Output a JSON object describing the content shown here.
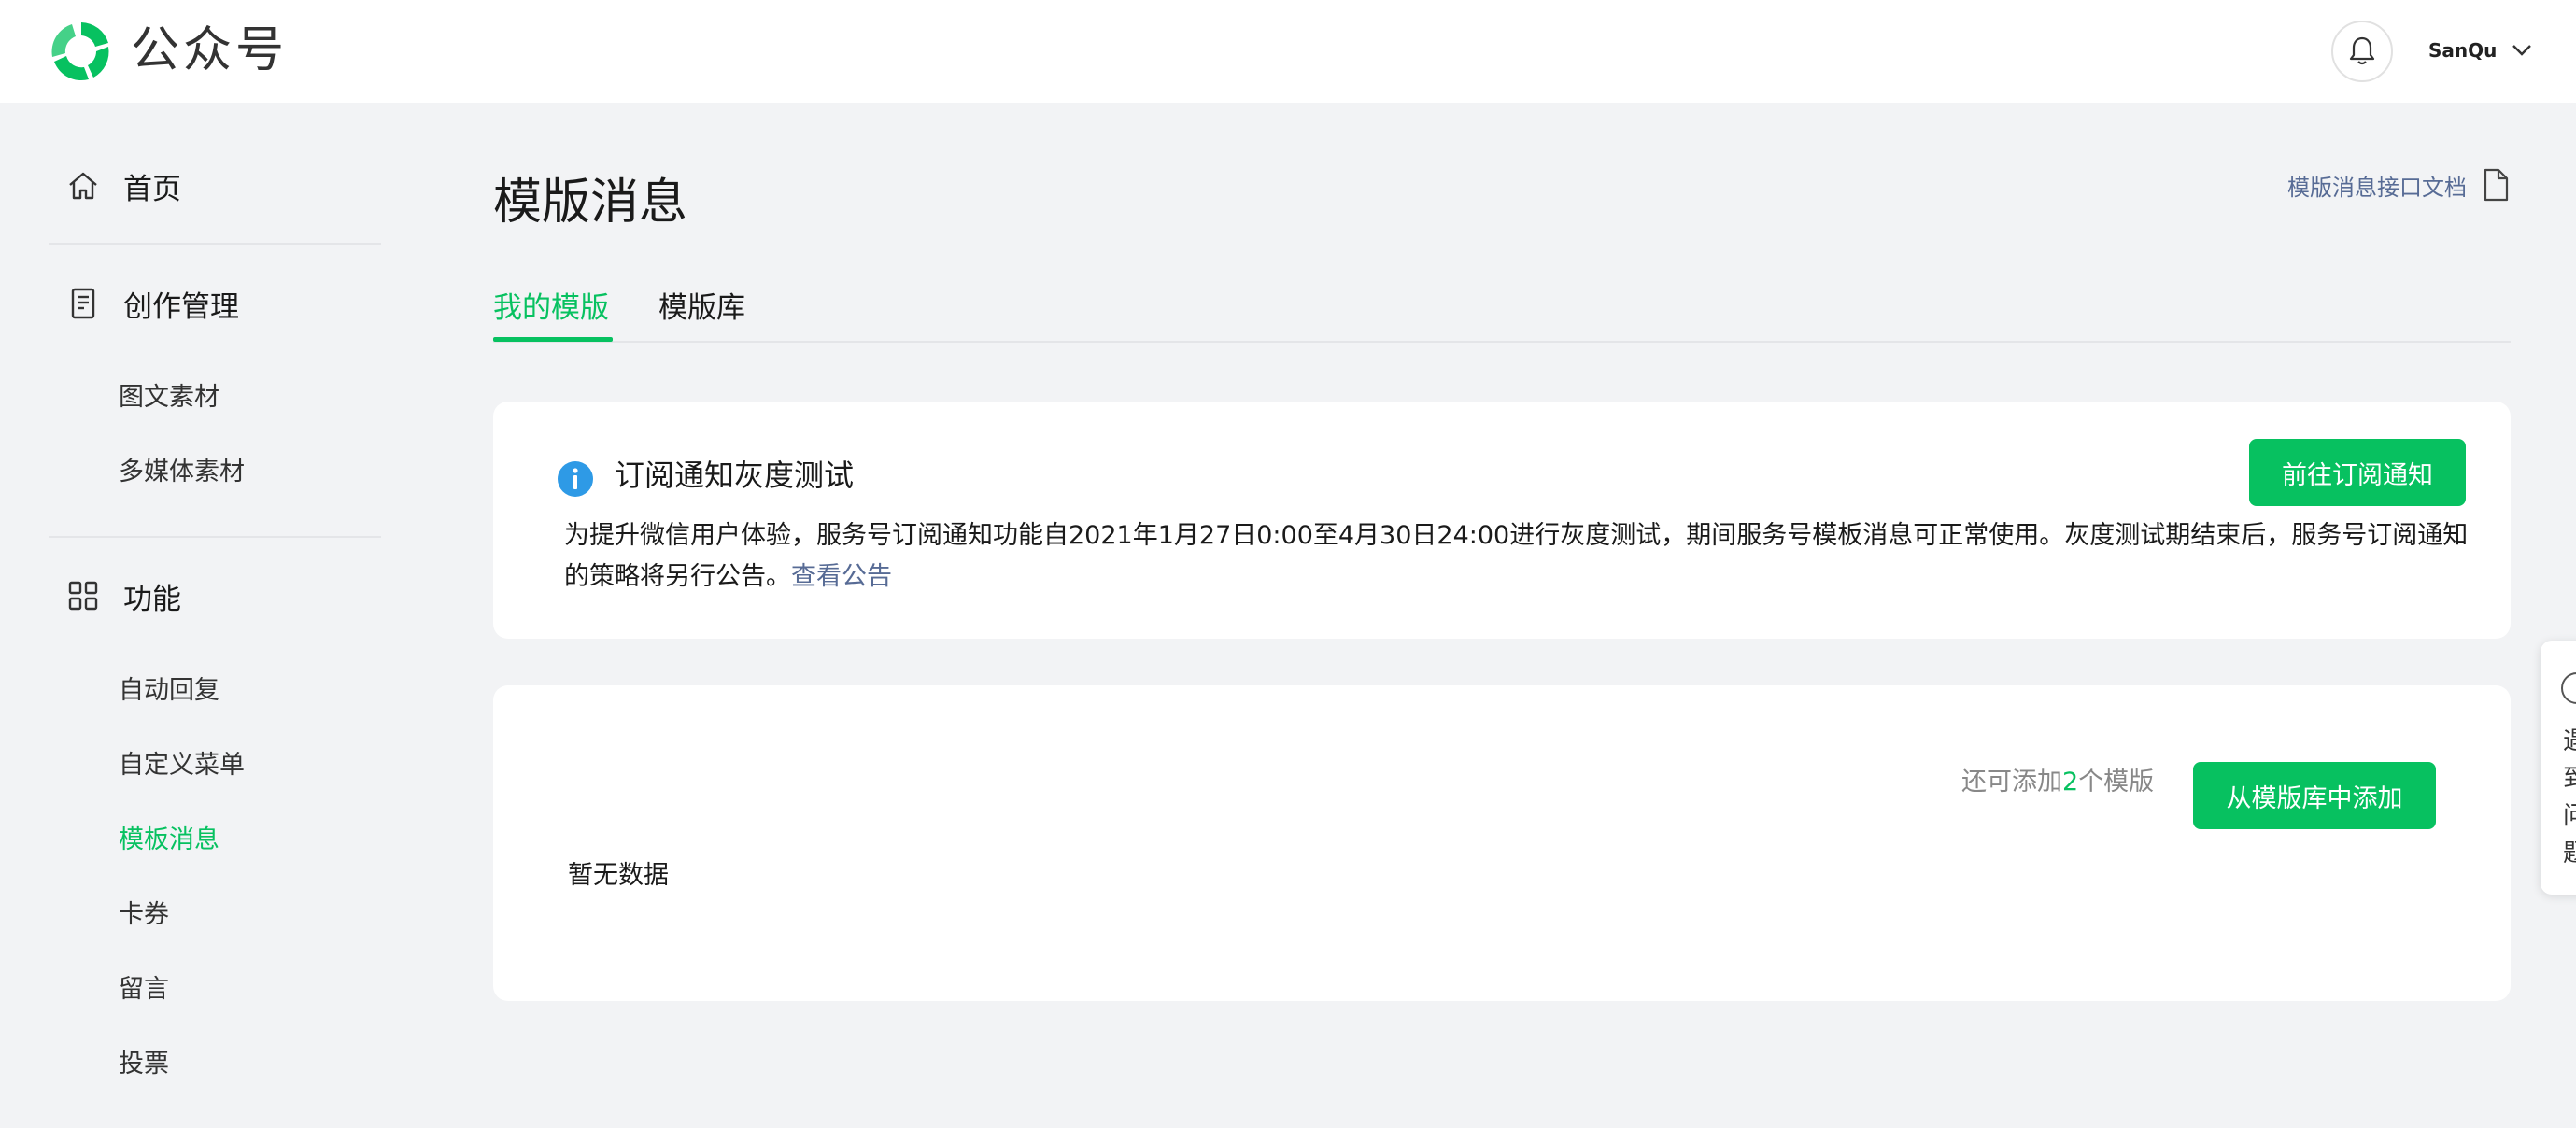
{
  "header": {
    "brand": "公众号",
    "logo_icon": "wechat-official-account-logo-icon",
    "bell_icon": "bell-icon",
    "username": "SanQu"
  },
  "sidebar": {
    "home": {
      "label": "首页",
      "icon": "home-icon"
    },
    "creation": {
      "label": "创作管理",
      "icon": "document-icon",
      "items": [
        {
          "label": "图文素材"
        },
        {
          "label": "多媒体素材"
        }
      ]
    },
    "features": {
      "label": "功能",
      "icon": "grid-icon",
      "items": [
        {
          "label": "自动回复"
        },
        {
          "label": "自定义菜单"
        },
        {
          "label": "模板消息",
          "active": true
        },
        {
          "label": "卡券"
        },
        {
          "label": "留言"
        },
        {
          "label": "投票"
        }
      ]
    }
  },
  "main": {
    "title": "模版消息",
    "doc_link": "模版消息接口文档",
    "tabs": [
      {
        "label": "我的模版",
        "active": true
      },
      {
        "label": "模版库"
      }
    ],
    "notice": {
      "title": "订阅通知灰度测试",
      "button": "前往订阅通知",
      "body": "为提升微信用户体验，服务号订阅通知功能自2021年1月27日0:00至4月30日24:00进行灰度测试，期间服务号模板消息可正常使用。灰度测试期结束后，服务号订阅通知的策略将另行公告。",
      "link": "查看公告"
    },
    "templates": {
      "quota_prefix": "还可添加",
      "quota_count": "2",
      "quota_suffix": "个模版",
      "add_button": "从模版库中添加",
      "empty_text": "暂无数据"
    }
  },
  "float_panel": {
    "text": "遇到问题"
  },
  "colors": {
    "accent": "#07c160",
    "link": "#576b95",
    "background": "#f2f3f5",
    "info": "#2e9ae6"
  }
}
